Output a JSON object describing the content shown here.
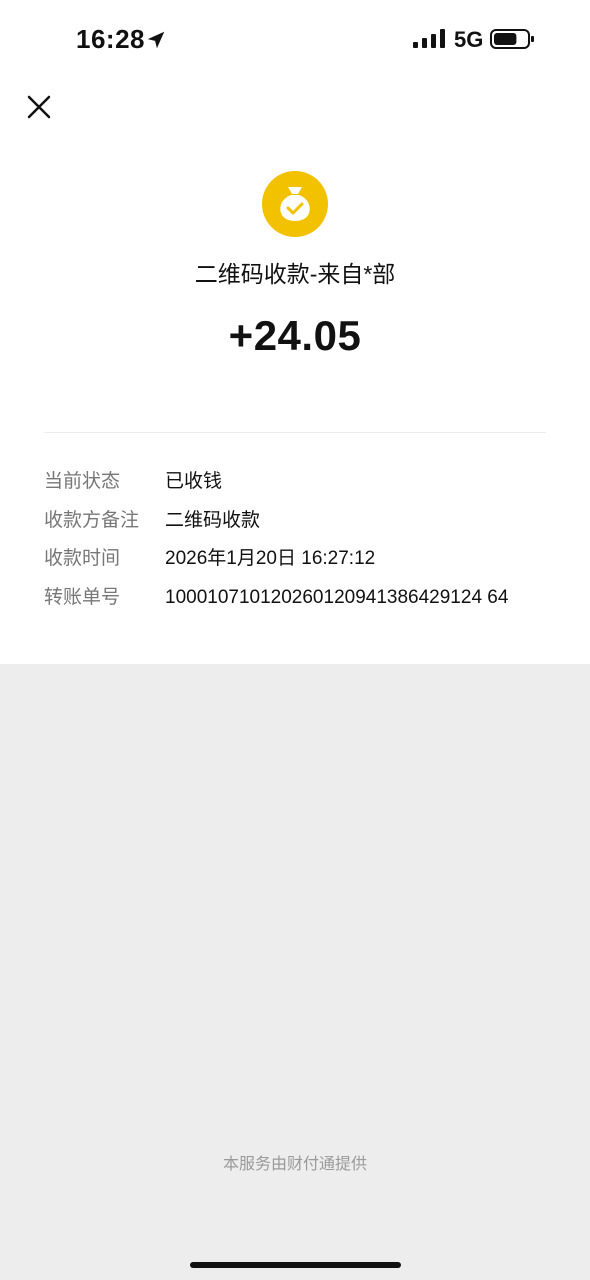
{
  "status_bar": {
    "time": "16:28",
    "network": "5G",
    "battery_level": 0.7
  },
  "icons": {
    "close": "close-icon",
    "header": "money-bag-check-icon",
    "location": "location-arrow-icon",
    "signal": "signal-icon",
    "battery": "battery-icon"
  },
  "colors": {
    "accent": "#f2c100",
    "background": "#ededed",
    "card": "#ffffff"
  },
  "transaction": {
    "title": "二维码收款-来自*部",
    "amount": "+24.05"
  },
  "details": [
    {
      "label": "当前状态",
      "value": "已收钱"
    },
    {
      "label": "收款方备注",
      "value": "二维码收款"
    },
    {
      "label": "收款时间",
      "value": "2026年1月20日 16:27:12"
    },
    {
      "label": "转账单号",
      "value": "100010710120260120941386429124 64"
    }
  ],
  "footer": {
    "note": "本服务由财付通提供"
  }
}
